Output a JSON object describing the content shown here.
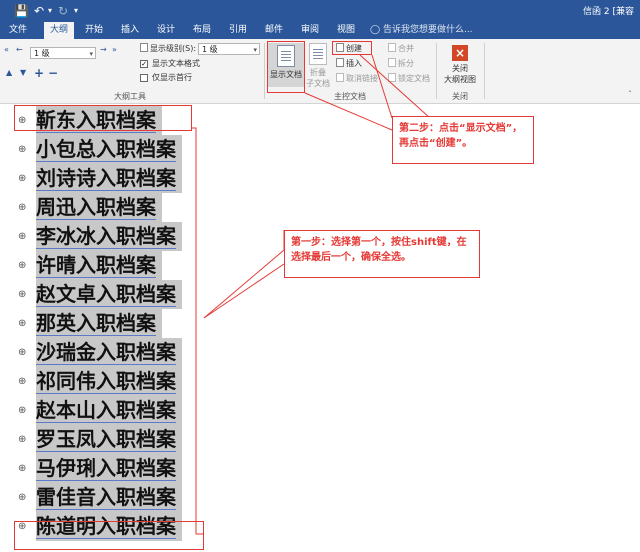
{
  "titlebar": {
    "save_icon": "save-icon",
    "undo_icon": "undo-icon",
    "redo_icon": "redo-icon",
    "customize_icon": "customize-icon",
    "doc_title": "信函 2 [兼容"
  },
  "tabs": [
    "文件",
    "大纲",
    "开始",
    "插入",
    "设计",
    "布局",
    "引用",
    "邮件",
    "审阅",
    "视图"
  ],
  "active_tab": "大纲",
  "tell_me": "告诉我您想要做什么...",
  "outline_tools": {
    "level_label": "显示级别(S):",
    "level_value": "1 级",
    "left_level_value": "1 级",
    "show_format": "显示文本格式",
    "show_first_line": "仅显示首行",
    "show_format_checked": true,
    "show_first_line_checked": false,
    "group_label": "大纲工具"
  },
  "master_doc": {
    "show_doc": "显示文档",
    "collapse_sub": [
      "折叠",
      "子文档"
    ],
    "create": "创建",
    "insert": "插入",
    "unlink": "取消链接",
    "merge": "合并",
    "split": "拆分",
    "lock_doc": "锁定文档",
    "group_label": "主控文档"
  },
  "close_group": {
    "close_label": [
      "关闭",
      "大纲视图"
    ],
    "group_label": "关闭"
  },
  "outline_items": [
    "靳东入职档案",
    "小包总入职档案",
    "刘诗诗入职档案",
    "周迅入职档案",
    "李冰冰入职档案",
    "许晴入职档案",
    "赵文卓入职档案",
    "那英入职档案",
    "沙瑞金入职档案",
    "祁同伟入职档案",
    "赵本山入职档案",
    "罗玉凤入职档案",
    "马伊琍入职档案",
    "雷佳音入职档案",
    "陈道明入职档案"
  ],
  "callouts": {
    "step1": "第一步：选择第一个，按住shift键，在选择最后一个，确保全选。",
    "step2": "第二步：点击“显示文档”，再点击“创建”。"
  },
  "colors": {
    "brand": "#2b579a",
    "annotation": "#e53935",
    "selection": "#c8c8c8"
  }
}
